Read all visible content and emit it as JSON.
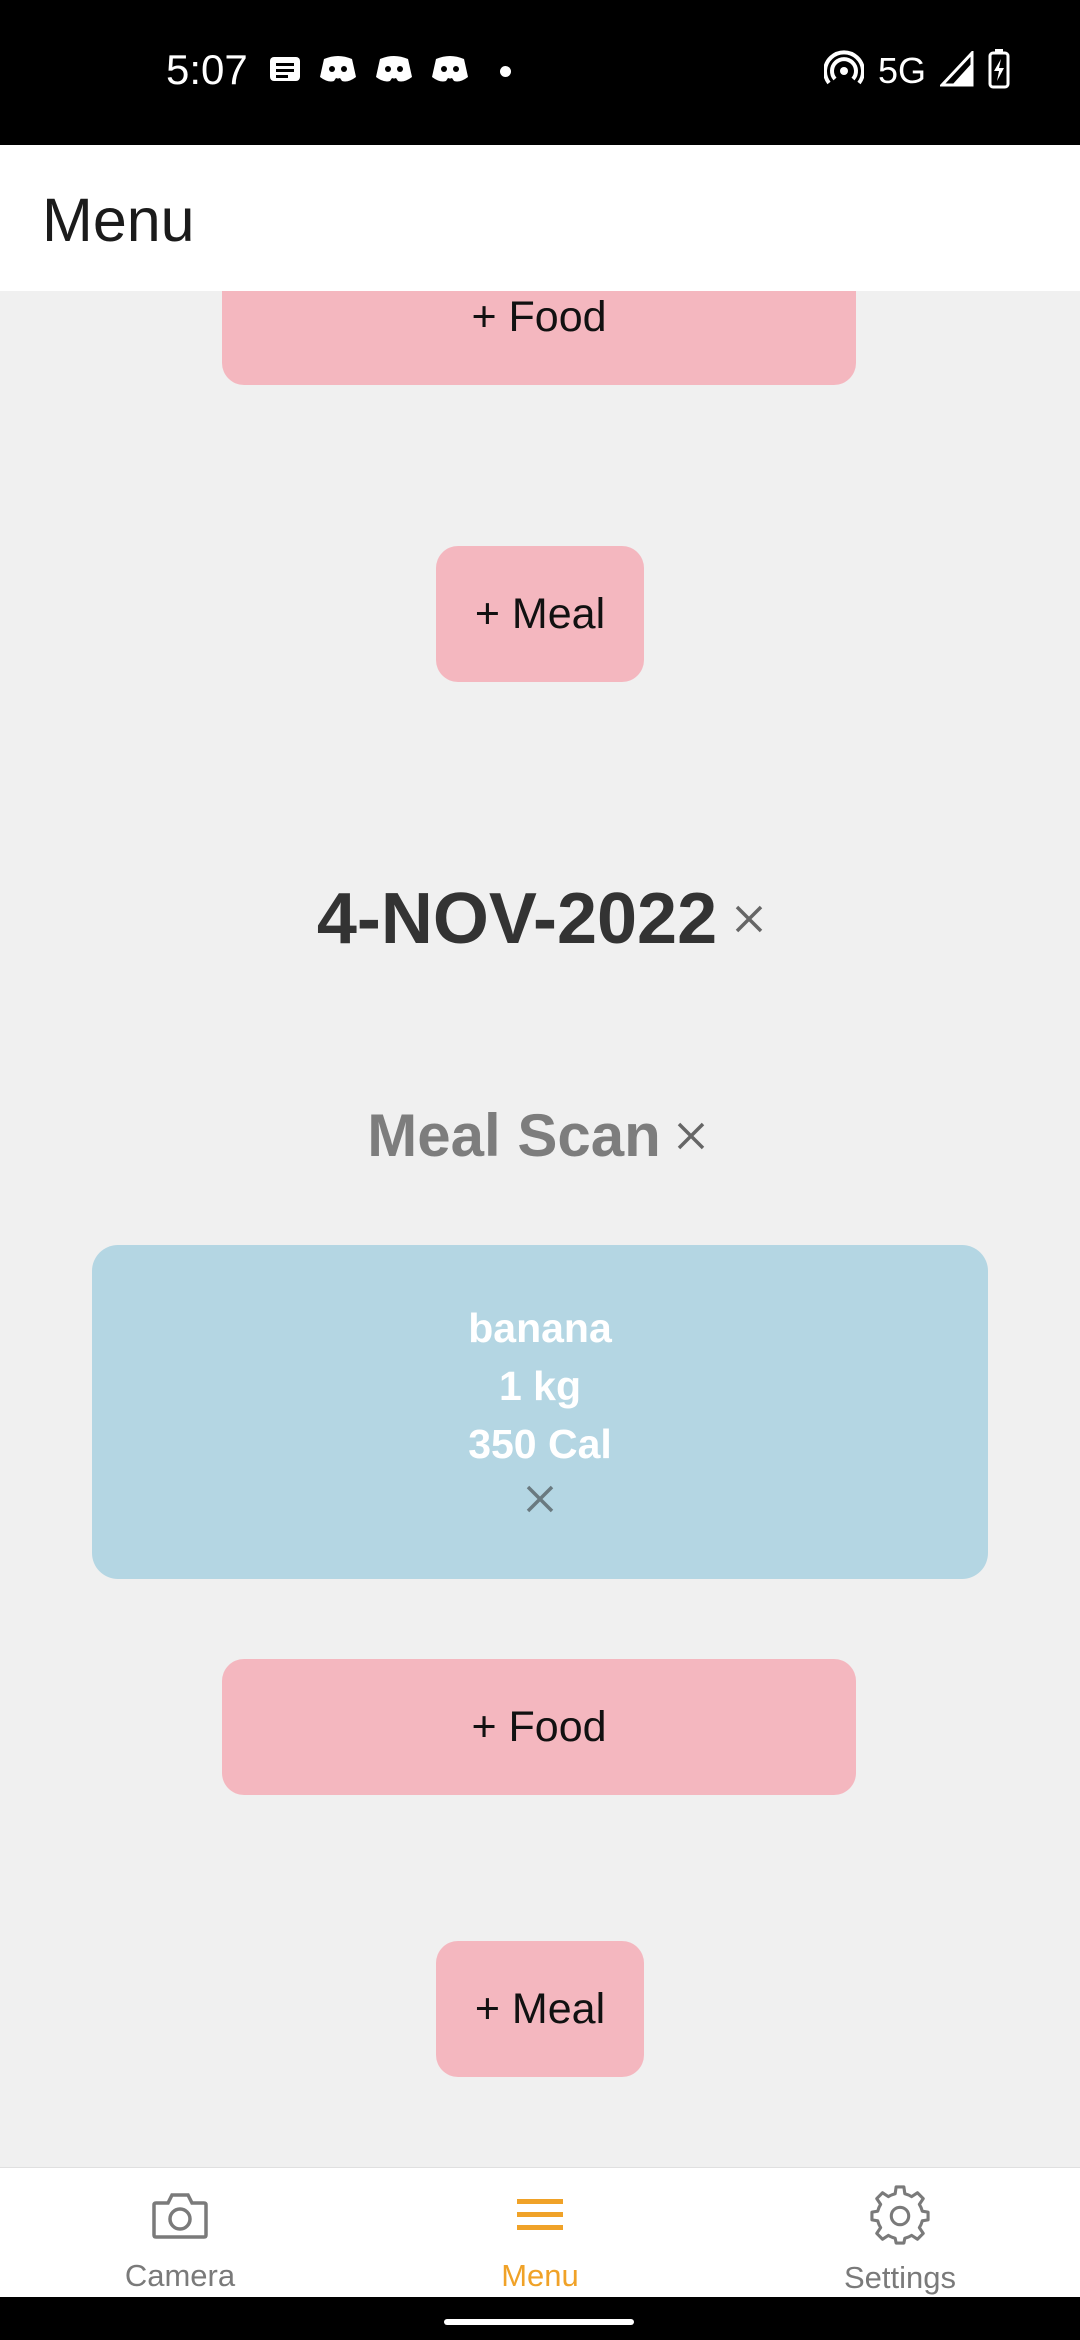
{
  "status_bar": {
    "time": "5:07",
    "network": "5G",
    "left_icons": [
      "message-icon",
      "discord-icon",
      "discord-icon",
      "discord-icon",
      "dot-icon"
    ],
    "right_icons": [
      "hotspot-icon",
      "signal-icon",
      "battery-charging-icon"
    ]
  },
  "header": {
    "title": "Menu"
  },
  "content": {
    "top_food_button": "+ Food",
    "top_meal_button": "+ Meal",
    "date": "4-NOV-2022",
    "meal_title": "Meal Scan",
    "food_item": {
      "name": "banana",
      "quantity": "1 kg",
      "calories": "350 Cal"
    },
    "food_button": "+ Food",
    "meal_button": "+ Meal"
  },
  "nav": {
    "items": [
      {
        "label": "Camera",
        "icon": "camera-icon",
        "active": false
      },
      {
        "label": "Menu",
        "icon": "menu-icon",
        "active": true
      },
      {
        "label": "Settings",
        "icon": "gear-icon",
        "active": false
      }
    ]
  },
  "colors": {
    "button_pink": "#f4b7bf",
    "card_blue": "#b4d6e3",
    "accent_active": "#f0a228",
    "inactive": "#7a7a7a"
  }
}
